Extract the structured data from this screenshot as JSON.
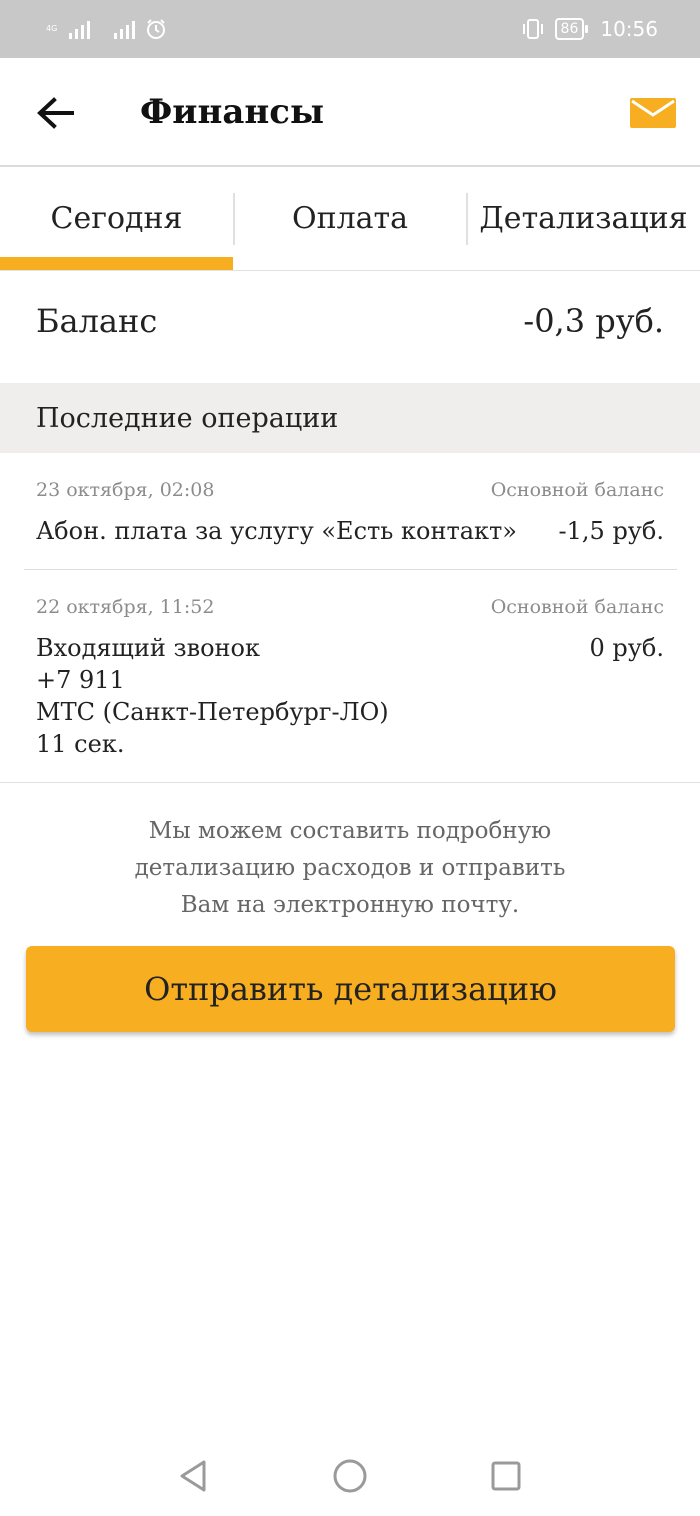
{
  "status_bar": {
    "network_label": "4G",
    "battery": "86",
    "time": "10:56",
    "icons": [
      "signal-icon",
      "signal-icon",
      "alarm-icon",
      "vibrate-icon",
      "battery-icon"
    ]
  },
  "header": {
    "title": "Финансы",
    "back_icon": "arrow-back-icon",
    "mail_icon": "envelope-icon"
  },
  "tabs": [
    {
      "label": "Сегодня",
      "active": true
    },
    {
      "label": "Оплата",
      "active": false
    },
    {
      "label": "Детализация",
      "active": false
    }
  ],
  "balance": {
    "label": "Баланс",
    "value": "-0,3 руб."
  },
  "operations_section": {
    "title": "Последние операции",
    "items": [
      {
        "date": "23 октября, 02:08",
        "account": "Основной баланс",
        "description_lines": [
          "Абон. плата за услугу «Есть контакт»"
        ],
        "amount": "-1,5 руб."
      },
      {
        "date": "22 октября, 11:52",
        "account": "Основной баланс",
        "description_lines": [
          "Входящий звонок",
          "+7 911",
          "МТС (Санкт-Петербург-ЛО)",
          "11 сек."
        ],
        "amount": "0 руб."
      }
    ]
  },
  "info_text_lines": [
    "Мы можем составить подробную",
    "детализацию расходов и отправить",
    "Вам на электронную почту."
  ],
  "send_button": {
    "label": "Отправить детализацию"
  },
  "colors": {
    "accent": "#f7ae20",
    "status_bar": "#c8c8c8",
    "section_bg": "#efeeed",
    "muted_text": "#8c8c8c"
  },
  "nav_bar": {
    "icons": [
      "back-triangle-icon",
      "home-circle-icon",
      "recents-square-icon"
    ]
  }
}
